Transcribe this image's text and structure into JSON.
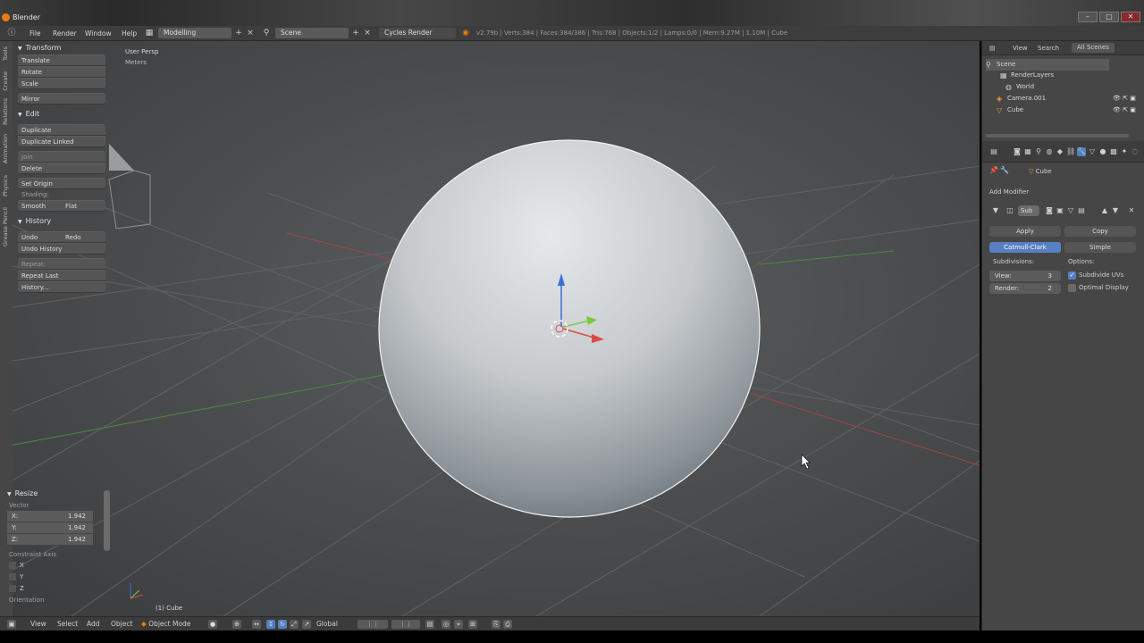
{
  "window": {
    "title": "Blender",
    "min": "–",
    "max": "□",
    "close": "✕"
  },
  "menu": {
    "file": "File",
    "render": "Render",
    "window": "Window",
    "help": "Help",
    "screen": "Modelling",
    "scene": "Scene",
    "engine": "Cycles Render",
    "stats": "v2.79b | Verts:384 | Faces:384/386 | Tris:768 | Objects:1/2 | Lamps:0/0 | Mem:9.27M | 1.10M | Cube"
  },
  "toolshelf": {
    "tabs": [
      "Tools",
      "Create",
      "Relations",
      "Animation",
      "Physics",
      "Grease Pencil"
    ],
    "transform": {
      "title": "Transform",
      "translate": "Translate",
      "rotate": "Rotate",
      "scale": "Scale",
      "mirror": "Mirror"
    },
    "edit": {
      "title": "Edit",
      "duplicate": "Duplicate",
      "duplicate_linked": "Duplicate Linked",
      "join": "Join",
      "delete": "Delete",
      "set_origin": "Set Origin",
      "shading": "Shading:",
      "smooth": "Smooth",
      "flat": "Flat"
    },
    "history": {
      "title": "History",
      "undo": "Undo",
      "redo": "Redo",
      "undo_history": "Undo History",
      "repeat": "Repeat:",
      "repeat_last": "Repeat Last",
      "history": "History..."
    }
  },
  "operator": {
    "title": "Resize",
    "vector_label": "Vector",
    "x_label": "X:",
    "x": "1.942",
    "y_label": "Y:",
    "y": "1.942",
    "z_label": "Z:",
    "z": "1.942",
    "constraint_label": "Constraint Axis",
    "cx": "X",
    "cy": "Y",
    "cz": "Z",
    "orientation": "Orientation"
  },
  "viewport": {
    "view_name": "User Persp",
    "units": "Meters",
    "object_label": "(1) Cube"
  },
  "bottombar": {
    "view": "View",
    "select": "Select",
    "add": "Add",
    "object": "Object",
    "mode": "Object Mode",
    "orientation": "Global"
  },
  "outliner": {
    "view": "View",
    "search": "Search",
    "filter": "All Scenes",
    "items": [
      "Scene",
      "RenderLayers",
      "World",
      "Camera.001",
      "Cube"
    ]
  },
  "properties": {
    "object_name": "Cube",
    "add_modifier": "Add Modifier",
    "mod_name": "Sub",
    "apply": "Apply",
    "copy": "Copy",
    "catmull": "Catmull-Clark",
    "simple": "Simple",
    "subdivisions": "Subdivisions:",
    "options": "Options:",
    "view_label": "View:",
    "view_value": "3",
    "render_label": "Render:",
    "render_value": "2",
    "subdivide_uvs": "Subdivide UVs",
    "optimal_display": "Optimal Display"
  },
  "colors": {
    "accent": "#5680c2",
    "viewport_bg": "#505254",
    "panel": "#464646",
    "x_axis": "#d94b4b",
    "y_axis": "#7ac943",
    "z_axis": "#3b6fd9"
  }
}
